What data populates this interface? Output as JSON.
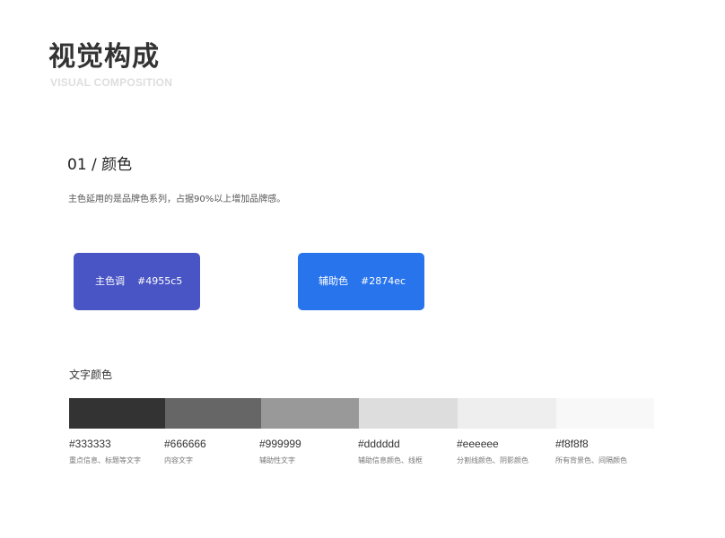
{
  "header": {
    "title": "视觉构成",
    "subtitle": "VISUAL COMPOSITION"
  },
  "section": {
    "heading": "01 / 颜色",
    "description": "主色延用的是品牌色系列，占据90%以上增加品牌感。"
  },
  "brand_colors": [
    {
      "label": "主色调",
      "hex": "#4955c5"
    },
    {
      "label": "辅助色",
      "hex": "#2874ec"
    }
  ],
  "text_colors": {
    "heading": "文字颜色",
    "items": [
      {
        "hex": "#333333",
        "usage": "重点信息、标题等文字"
      },
      {
        "hex": "#666666",
        "usage": "内容文字"
      },
      {
        "hex": "#999999",
        "usage": "辅助性文字"
      },
      {
        "hex": "#dddddd",
        "usage": "辅助信息颜色、线框"
      },
      {
        "hex": "#eeeeee",
        "usage": "分割线颜色、阴影颜色"
      },
      {
        "hex": "#f8f8f8",
        "usage": "所有背景色、间隔颜色"
      }
    ]
  }
}
